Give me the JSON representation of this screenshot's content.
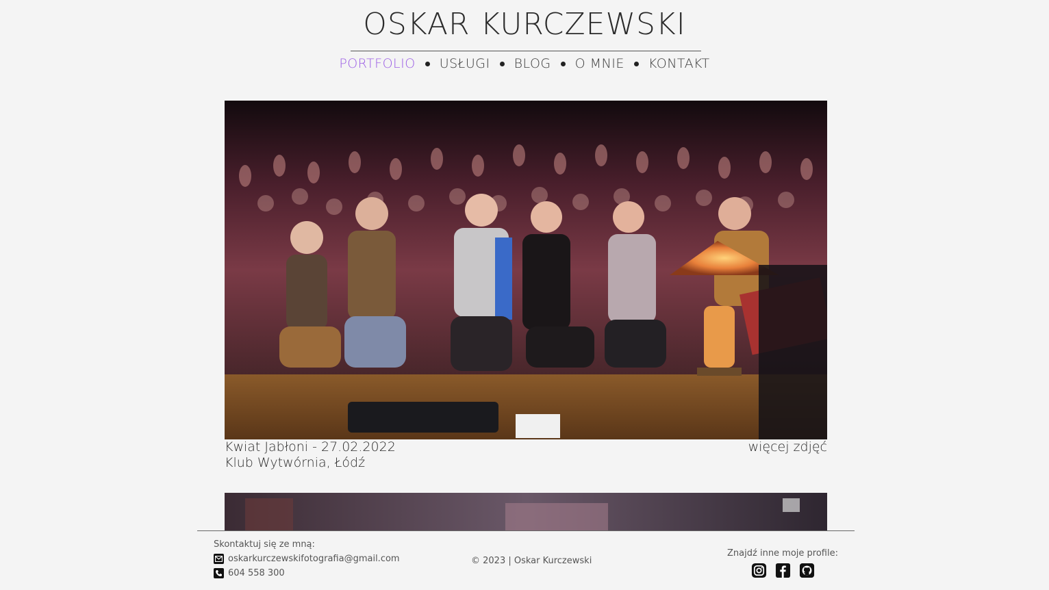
{
  "header": {
    "title": "OSKAR KURCZEWSKI",
    "nav": [
      {
        "label": "PORTFOLIO",
        "active": true
      },
      {
        "label": "USŁUGI",
        "active": false
      },
      {
        "label": "BLOG",
        "active": false
      },
      {
        "label": "O MNIE",
        "active": false
      },
      {
        "label": "KONTAKT",
        "active": false
      }
    ],
    "accent_color": "#9b5de5"
  },
  "gallery": {
    "items": [
      {
        "title_line": "Kwiat Jabłoni - 27.02.2022",
        "venue_line": "Klub Wytwórnia, Łódź",
        "more_link": "więcej zdjęć"
      }
    ]
  },
  "footer": {
    "contact_heading": "Skontaktuj się ze mną:",
    "email": "oskarkurczewskifotografia@gmail.com",
    "phone": "604 558 300",
    "copyright": "© 2023 | Oskar Kurczewski",
    "profiles_heading": "Znajdź inne moje profile:",
    "profiles": [
      "instagram-icon",
      "facebook-icon",
      "github-icon"
    ]
  }
}
